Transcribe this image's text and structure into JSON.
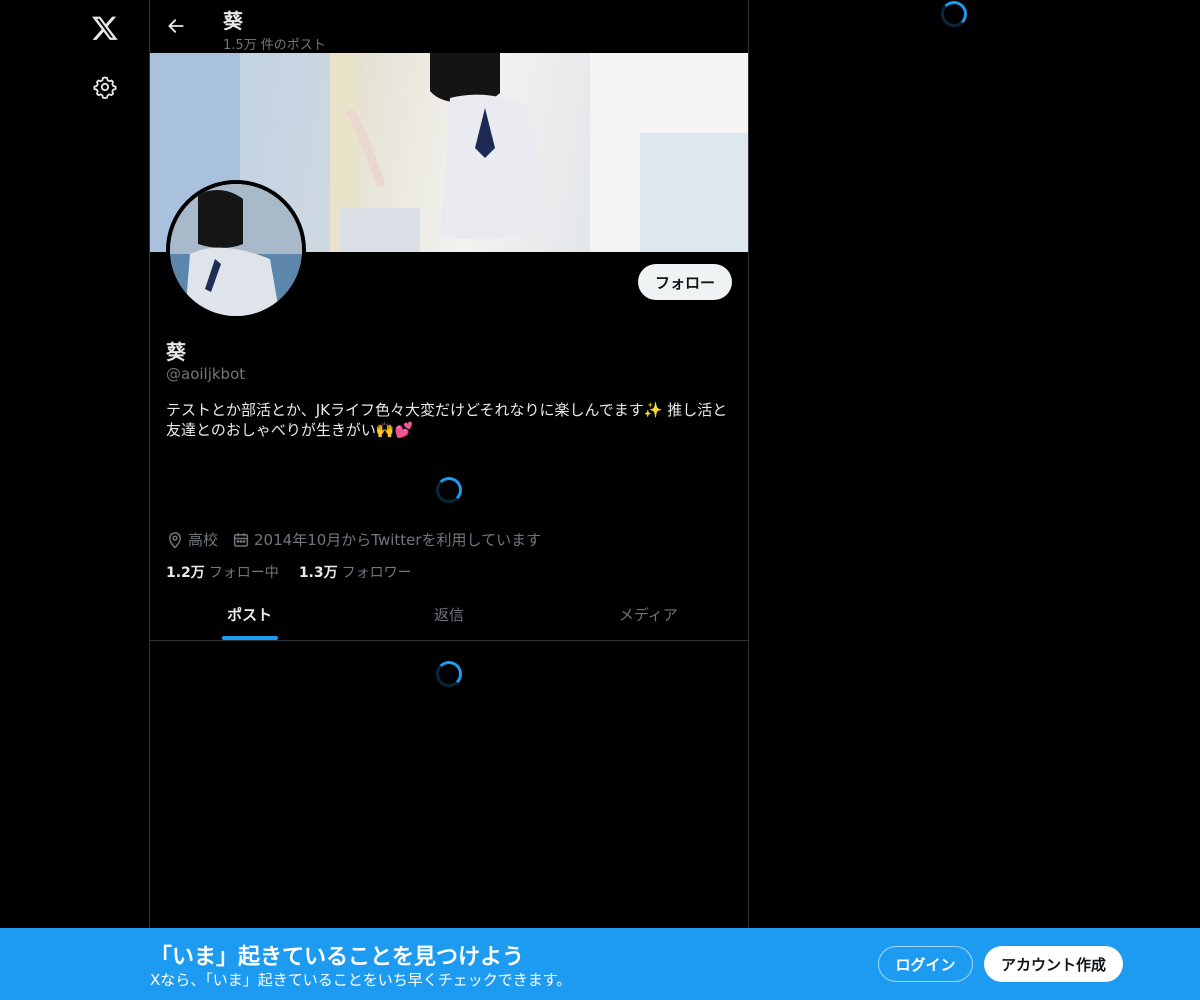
{
  "nav": {
    "logo_icon": "x-logo-icon",
    "settings_icon": "gear-icon"
  },
  "header": {
    "title": "葵",
    "post_count": "1.5万 件のポスト"
  },
  "profile": {
    "display_name": "葵",
    "handle": "@aoiljkbot",
    "follow_label": "フォロー",
    "bio_line1": "テストとか部活とか、JKライフ色々大変だけどそれなりに楽しんでます✨ 推し活と",
    "bio_line2": "友達とのおしゃべりが生きがい🙌💕",
    "location": "高校",
    "joined": "2014年10月からTwitterを利用しています",
    "following_count": "1.2万",
    "following_label": "フォロー中",
    "followers_count": "1.3万",
    "followers_label": "フォロワー"
  },
  "tabs": [
    {
      "label": "ポスト",
      "active": true
    },
    {
      "label": "返信",
      "active": false
    },
    {
      "label": "メディア",
      "active": false
    }
  ],
  "bottom_bar": {
    "title": "「いま」起きていることを見つけよう",
    "subtitle": "Xなら、「いま」起きていることをいち早くチェックできます。",
    "login_label": "ログイン",
    "signup_label": "アカウント作成"
  },
  "colors": {
    "accent": "#1d9bf0",
    "background": "#000000",
    "text_primary": "#e7e9ea",
    "text_secondary": "#71767b",
    "border": "#2f3336"
  }
}
